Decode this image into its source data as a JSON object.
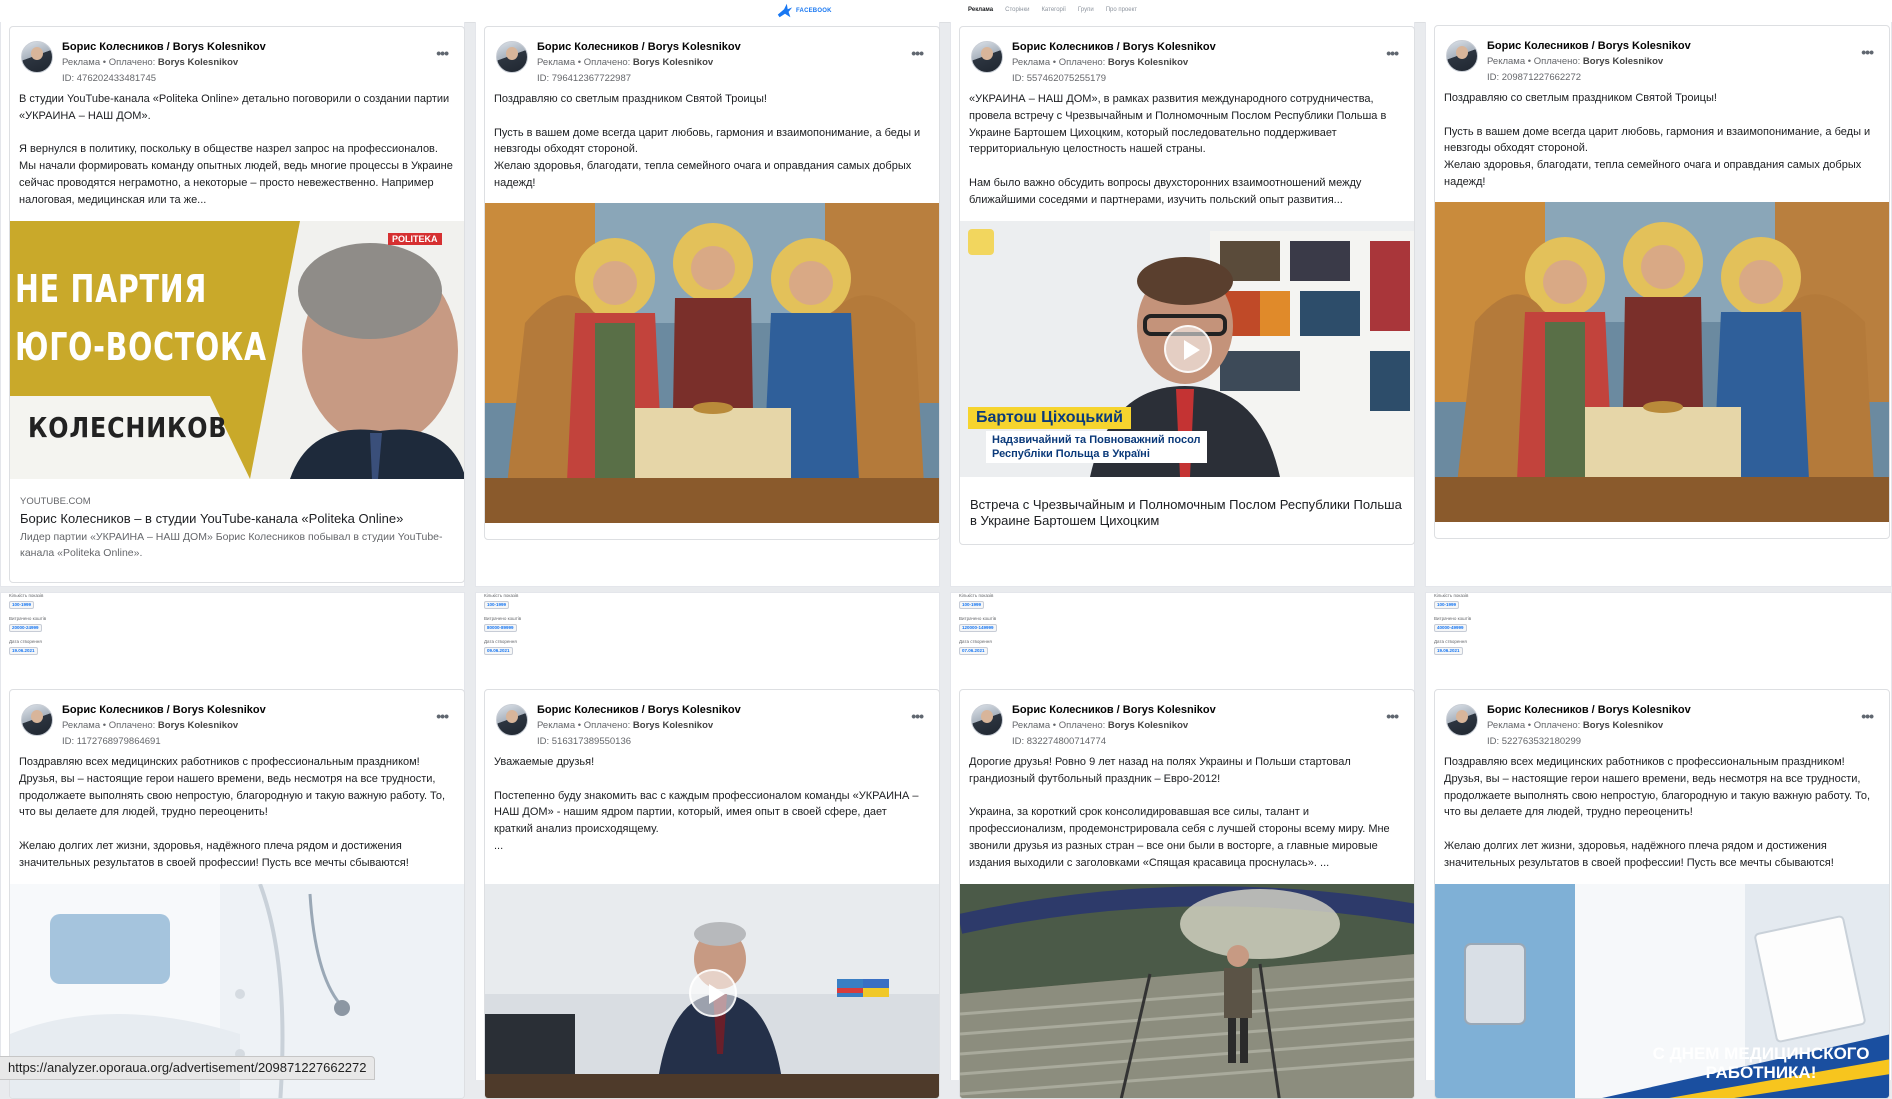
{
  "nav": {
    "logo_text": "FACEBOOK",
    "links": [
      "Реклама",
      "Сторінки",
      "Категорії",
      "Групи",
      "Про проект"
    ]
  },
  "posts": [
    {
      "author": "Борис Колесников / Borys Kolesnikov",
      "meta_prefix": "Реклама • Оплачено:",
      "meta_payer": "Borys Kolesnikov",
      "id": "ID: 476202433481745",
      "text": "В студии YouTube-канала «Politeka Online» детально поговорили о создании партии «УКРАИНА – НАШ ДОМ».\n\nЯ вернулся в политику, поскольку в обществе назрел запрос на профессионалов. Мы начали формировать команду опытных людей, ведь многие процессы в Украине сейчас проводятся неграмотно, а некоторые – просто невежественно. Например налоговая, медицинская или та же...",
      "image": {
        "line1": "НЕ ПАРТИЯ",
        "line2": "ЮГО-ВОСТОКА",
        "line3": "КОЛЕСНИКОВ",
        "badge": "POLITEKA"
      },
      "link": {
        "domain": "YOUTUBE.COM",
        "title": "Борис Колесников – в студии YouTube-канала «Politeka Online»",
        "desc": "Лидер партии «УКРАИНА – НАШ ДОМ» Борис Колесников побывал в студии YouTube-канала «Politeka Online»."
      }
    },
    {
      "author": "Борис Колесников / Borys Kolesnikov",
      "meta_prefix": "Реклама • Оплачено:",
      "meta_payer": "Borys Kolesnikov",
      "id": "ID: 796412367722987",
      "text": "Поздравляю со светлым праздником Святой Троицы!\n\nПусть в вашем доме всегда царит любовь, гармония и взаимопонимание, а беды и невзгоды обходят стороной.\nЖелаю здоровья, благодати, тепла семейного очага и оправдания самых добрых надежд!"
    },
    {
      "author": "Борис Колесников / Borys Kolesnikov",
      "meta_prefix": "Реклама • Оплачено:",
      "meta_payer": "Borys Kolesnikov",
      "id": "ID: 557462075255179",
      "text": "«УКРАИНА – НАШ ДОМ», в рамках развития международного сотрудничества, провела встречу с Чрезвычайным и Полномочным Послом Республики Польша в Украине Бартошем Цихоцким, который последовательно поддерживает территориальную целостность нашей страны.\n\nНам было важно обсудить вопросы двухсторонних взаимоотношений между ближайшими соседями и партнерами, изучить польский опыт развития...",
      "video": {
        "name": "Бартош Ціхоцький",
        "role1": "Надзвичайний та Повноважний посол",
        "role2": "Республіки Польща в Україні"
      },
      "caption": "Встреча с Чрезвычайным и Полномочным Послом Республики Польша в Украине Бартошем Цихоцким"
    },
    {
      "author": "Борис Колесников / Borys Kolesnikov",
      "meta_prefix": "Реклама • Оплачено:",
      "meta_payer": "Borys Kolesnikov",
      "id": "ID: 209871227662272",
      "text": "Поздравляю со светлым праздником Святой Троицы!\n\nПусть в вашем доме всегда царит любовь, гармония и взаимопонимание, а беды и невзгоды обходят стороной.\nЖелаю здоровья, благодати, тепла семейного очага и оправдания самых добрых надежд!"
    },
    {
      "author": "Борис Колесников / Borys Kolesnikov",
      "meta_prefix": "Реклама • Оплачено:",
      "meta_payer": "Borys Kolesnikov",
      "id": "ID: 1172768979864691",
      "text": "Поздравляю всех медицинских работников с профессиональным праздником! Друзья, вы – настоящие герои нашего времени, ведь несмотря на все трудности, продолжаете выполнять свою непростую, благородную и такую важную работу. То, что вы делаете для людей, трудно переоценить!\n\nЖелаю долгих лет жизни, здоровья, надёжного плеча рядом и достижения значительных результатов в своей профессии! Пусть все мечты сбываются!",
      "stats": [
        "Кількість показів",
        "100-1999",
        "Витрачено коштів",
        "20000-24999",
        "Дата створення",
        "19.06.2021"
      ]
    },
    {
      "author": "Борис Колесников / Borys Kolesnikov",
      "meta_prefix": "Реклама • Оплачено:",
      "meta_payer": "Borys Kolesnikov",
      "id": "ID: 516317389550136",
      "text": "Уважаемые друзья!\n\nПостепенно буду знакомить вас с каждым профессионалом команды «УКРАИНА – НАШ ДОМ» - нашим ядром партии, который, имея опыт в своей сфере, дает\nкраткий анализ происходящему.\n...",
      "stats": [
        "Кількість показів",
        "100-1999",
        "Витрачено коштів",
        "80000-89999",
        "Дата створення",
        "09.06.2021"
      ]
    },
    {
      "author": "Борис Колесников / Borys Kolesnikov",
      "meta_prefix": "Реклама • Оплачено:",
      "meta_payer": "Borys Kolesnikov",
      "id": "ID: 832274800714774",
      "text": "Дорогие друзья! Ровно 9 лет назад на полях Украины и Польши стартовал грандиозный футбольный праздник – Евро-2012!\n\nУкраина, за короткий срок консолидировавшая все силы, талант и профессионализм, продемонстрировала себя с лучшей стороны всему миру. Мне звонили друзья из разных стран – все они были в восторге, а главные мировые издания выходили с заголовками «Спящая красавица проснулась». ...",
      "stats": [
        "Кількість показів",
        "100-1999",
        "Витрачено коштів",
        "120000-149999",
        "Дата створення",
        "07.06.2021"
      ]
    },
    {
      "author": "Борис Колесников / Borys Kolesnikov",
      "meta_prefix": "Реклама • Оплачено:",
      "meta_payer": "Borys Kolesnikov",
      "id": "ID: 522763532180299",
      "text": "Поздравляю всех медицинских работников с профессиональным праздником! Друзья, вы – настоящие герои нашего времени, ведь несмотря на все трудности, продолжаете выполнять свою непростую, благородную и такую важную работу. То, что вы делаете для людей, трудно переоценить!\n\nЖелаю долгих лет жизни, здоровья, надёжного плеча рядом и достижения значительных результатов в своей профессии! Пусть все мечты сбываются!",
      "image_text": "С ДНЕМ МЕДИЦИНСКОГО\nРАБОТНИКА!",
      "stats": [
        "Кількість показів",
        "100-1999",
        "Витрачено коштів",
        "40000-49999",
        "Дата створення",
        "19.06.2021"
      ]
    }
  ],
  "statusbar": "https://analyzer.oporaua.org/advertisement/209871227662272",
  "colors": {
    "accent": "#1877f2",
    "banner_yellow": "#c9a92a"
  }
}
